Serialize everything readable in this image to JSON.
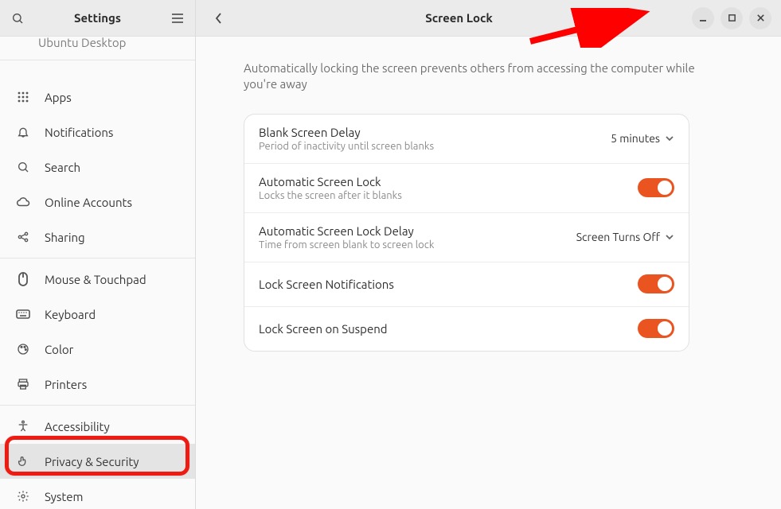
{
  "sidebar": {
    "title": "Settings",
    "items": [
      {
        "label": "Ubuntu Desktop",
        "icon": "desktop-icon"
      },
      {
        "label": "Apps",
        "icon": "grid-icon"
      },
      {
        "label": "Notifications",
        "icon": "bell-icon"
      },
      {
        "label": "Search",
        "icon": "search-icon"
      },
      {
        "label": "Online Accounts",
        "icon": "cloud-icon"
      },
      {
        "label": "Sharing",
        "icon": "share-icon"
      },
      {
        "label": "Mouse & Touchpad",
        "icon": "mouse-icon"
      },
      {
        "label": "Keyboard",
        "icon": "keyboard-icon"
      },
      {
        "label": "Color",
        "icon": "color-icon"
      },
      {
        "label": "Printers",
        "icon": "printer-icon"
      },
      {
        "label": "Accessibility",
        "icon": "accessibility-icon"
      },
      {
        "label": "Privacy & Security",
        "icon": "hand-icon"
      },
      {
        "label": "System",
        "icon": "gear-icon"
      }
    ]
  },
  "header": {
    "title": "Screen Lock"
  },
  "description": "Automatically locking the screen prevents others from accessing the computer while you're away",
  "rows": {
    "blankDelay": {
      "title": "Blank Screen Delay",
      "sub": "Period of inactivity until screen blanks",
      "value": "5 minutes"
    },
    "autoLock": {
      "title": "Automatic Screen Lock",
      "sub": "Locks the screen after it blanks",
      "on": true
    },
    "autoLockDelay": {
      "title": "Automatic Screen Lock Delay",
      "sub": "Time from screen blank to screen lock",
      "value": "Screen Turns Off"
    },
    "lockNotif": {
      "title": "Lock Screen Notifications",
      "on": true
    },
    "lockSuspend": {
      "title": "Lock Screen on Suspend",
      "on": true
    }
  },
  "annotation": {
    "arrow_color": "#ff0000",
    "box_color": "#ef1a12"
  }
}
